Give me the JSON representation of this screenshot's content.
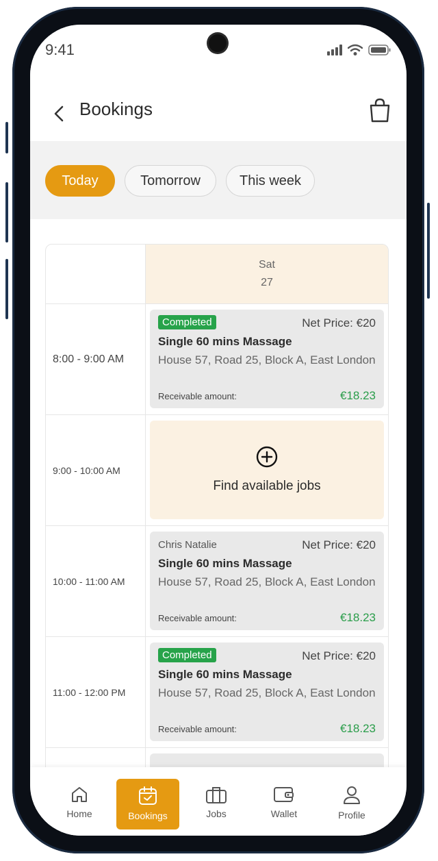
{
  "status_bar": {
    "time": "9:41"
  },
  "header": {
    "title": "Bookings"
  },
  "filters": [
    {
      "label": "Today",
      "active": true
    },
    {
      "label": "Tomorrow",
      "active": false
    },
    {
      "label": "This week",
      "active": false
    }
  ],
  "calendar": {
    "day_name": "Sat",
    "day_number": "27",
    "slots": [
      {
        "time": "8:00 - 9:00 AM",
        "type": "booking",
        "tag": "Completed",
        "net_price": "Net Price: €20",
        "service": "Single 60 mins Massage",
        "address": "House 57, Road 25, Block A, East London",
        "receivable_label": "Receivable amount:",
        "receivable_amount": "€18.23"
      },
      {
        "time": "9:00 - 10:00 AM",
        "type": "empty",
        "label": "Find available jobs"
      },
      {
        "time": "10:00 - 11:00 AM",
        "type": "booking",
        "client": "Chris Natalie",
        "net_price": "Net Price: €20",
        "service": "Single 60 mins Massage",
        "address": "House 57, Road 25, Block A, East London",
        "receivable_label": "Receivable amount:",
        "receivable_amount": "€18.23"
      },
      {
        "time": "11:00 - 12:00 PM",
        "type": "booking",
        "tag": "Completed",
        "net_price": "Net Price: €20",
        "service": "Single 60 mins Massage",
        "address": "House 57, Road 25, Block A, East London",
        "receivable_label": "Receivable amount:",
        "receivable_amount": "€18.23"
      }
    ]
  },
  "nav": [
    {
      "label": "Home",
      "icon": "home-icon",
      "active": false
    },
    {
      "label": "Bookings",
      "icon": "calendar-icon",
      "active": true
    },
    {
      "label": "Jobs",
      "icon": "briefcase-icon",
      "active": false
    },
    {
      "label": "Wallet",
      "icon": "wallet-icon",
      "active": false
    },
    {
      "label": "Profile",
      "icon": "profile-icon",
      "active": false
    }
  ],
  "colors": {
    "accent": "#e59a12",
    "success": "#27a34a",
    "amount": "#2a9d4a",
    "highlight": "#fbf1e2"
  }
}
